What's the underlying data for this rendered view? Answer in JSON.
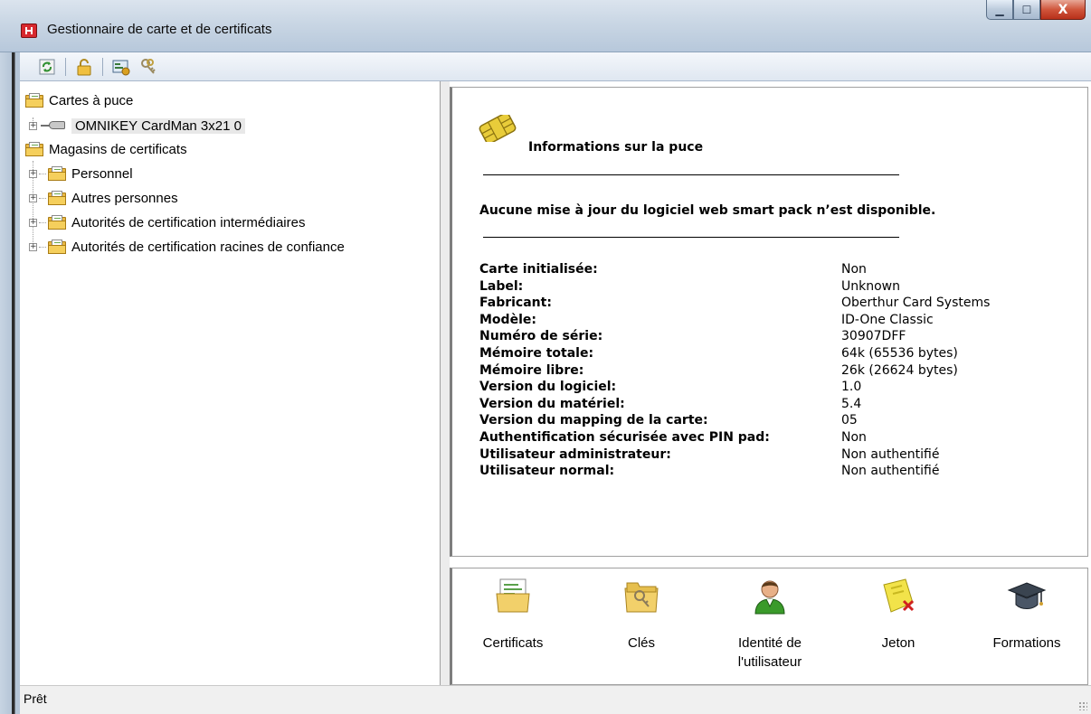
{
  "window": {
    "title": "Gestionnaire de carte et de certificats",
    "controls": {
      "minimize": "▁",
      "maximize": "☐",
      "close": "X"
    }
  },
  "toolbar": {
    "buttons": [
      {
        "icon": "refresh-icon"
      },
      {
        "icon": "unlock-icon"
      },
      {
        "icon": "card-list-icon"
      },
      {
        "icon": "keys-icon"
      }
    ]
  },
  "tree": {
    "smartcards": {
      "label": "Cartes à puce"
    },
    "reader": {
      "label": "OMNIKEY CardMan 3x21 0"
    },
    "stores": {
      "label": "Magasins de certificats"
    },
    "store_items": [
      {
        "label": "Personnel"
      },
      {
        "label": "Autres personnes"
      },
      {
        "label": "Autorités de certification intermédiaires"
      },
      {
        "label": "Autorités de certification racines de confiance"
      }
    ],
    "expander_symbol": "+"
  },
  "info": {
    "title": "Informations sur la puce",
    "update_message": "Aucune mise à jour du logiciel web smart pack n’est disponible.",
    "properties": [
      {
        "key": "Carte initialisée:",
        "value": "Non"
      },
      {
        "key": "Label:",
        "value": "Unknown"
      },
      {
        "key": "Fabricant:",
        "value": "Oberthur Card Systems"
      },
      {
        "key": "Modèle:",
        "value": "ID-One Classic"
      },
      {
        "key": "Numéro de série:",
        "value": "30907DFF"
      },
      {
        "key": "Mémoire totale:",
        "value": "64k (65536 bytes)"
      },
      {
        "key": "Mémoire libre:",
        "value": "26k (26624 bytes)"
      },
      {
        "key": "Version du logiciel:",
        "value": "1.0"
      },
      {
        "key": "Version du matériel:",
        "value": "5.4"
      },
      {
        "key": "Version du mapping de la carte:",
        "value": "05"
      },
      {
        "key": "Authentification sécurisée avec PIN pad:",
        "value": "Non"
      },
      {
        "key": "Utilisateur administrateur:",
        "value": "Non authentifié"
      },
      {
        "key": "Utilisateur normal:",
        "value": "Non authentifié"
      }
    ]
  },
  "actions": [
    {
      "label": "Certificats",
      "icon": "certificates-folder-icon"
    },
    {
      "label": "Clés",
      "icon": "keys-folder-icon"
    },
    {
      "label": "Identité de l'utilisateur",
      "icon": "user-identity-icon"
    },
    {
      "label": "Jeton",
      "icon": "token-icon"
    },
    {
      "label": "Formations",
      "icon": "graduation-cap-icon"
    }
  ],
  "status": {
    "text": "Prêt"
  },
  "colors": {
    "accent_red": "#d8282e",
    "folder_yellow": "#f5cf5c",
    "chip_gold": "#e0c030",
    "user_green": "#3a9a2a",
    "token_yellow": "#f2e34a"
  }
}
